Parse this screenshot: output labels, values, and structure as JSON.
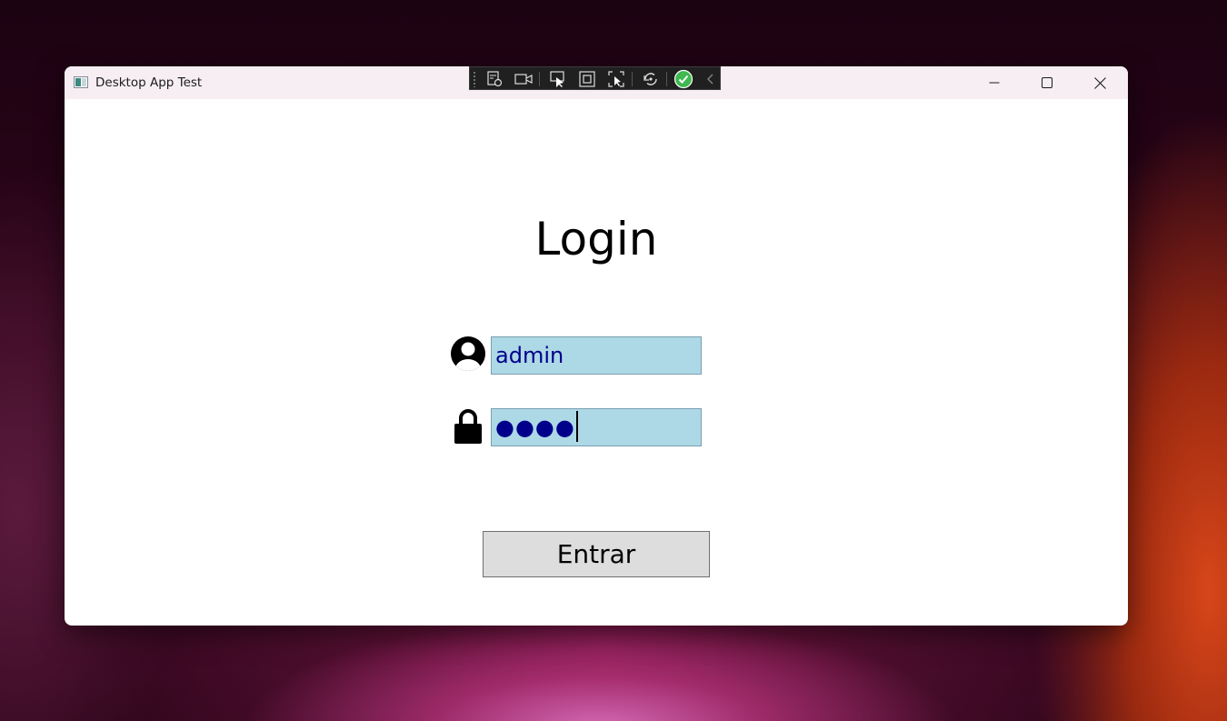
{
  "window": {
    "title": "Desktop App Test",
    "controls": {
      "minimize_icon": "minimize-icon",
      "maximize_icon": "maximize-icon",
      "close_icon": "close-icon"
    }
  },
  "devtools_toolbar": {
    "icons": [
      "live-visual-tree-icon",
      "record-icon",
      "select-element-icon",
      "display-layout-adorners-icon",
      "track-focused-element-icon",
      "hot-reload-icon",
      "binding-check-icon",
      "collapse-chevron-icon"
    ],
    "accent": "#3fb950"
  },
  "login": {
    "heading": "Login",
    "username": {
      "icon": "user-icon",
      "value": "admin"
    },
    "password": {
      "icon": "lock-icon",
      "masked_value": "●●●●"
    },
    "submit_label": "Entrar"
  },
  "colors": {
    "field_background": "#add8e6",
    "field_text": "#00008b",
    "button_background": "#dddddd",
    "titlebar_background": "#f6eef3"
  }
}
